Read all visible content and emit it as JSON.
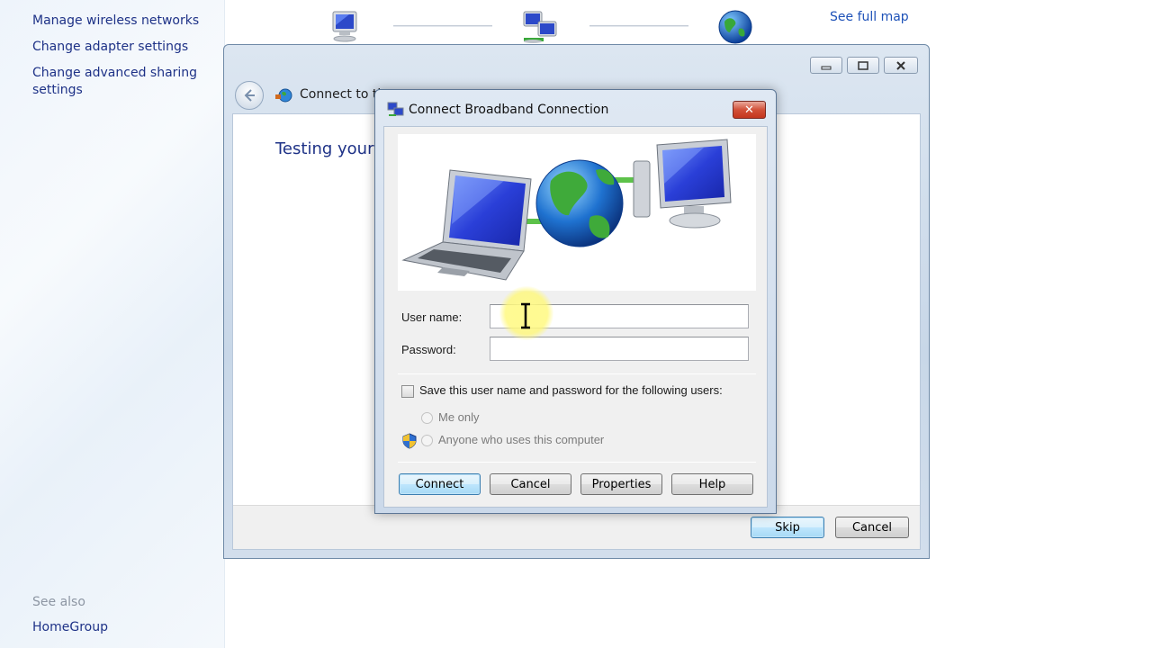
{
  "sidebar": {
    "links": [
      {
        "label": "Manage wireless networks"
      },
      {
        "label": "Change adapter settings"
      },
      {
        "label": "Change advanced sharing settings"
      }
    ],
    "see_also_heading": "See also",
    "see_also_links": [
      {
        "label": "HomeGroup"
      }
    ]
  },
  "network_map": {
    "see_full_map": "See full map",
    "icons": [
      "computer-icon",
      "network-icon",
      "globe-icon"
    ]
  },
  "wizard": {
    "title": "Connect to th",
    "heading": "Testing your",
    "skip_label": "Skip",
    "cancel_label": "Cancel"
  },
  "dialog": {
    "title": "Connect Broadband Connection",
    "close_glyph": "✕",
    "username_label": "User name:",
    "username_value": "",
    "password_label": "Password:",
    "password_value": "",
    "save_checkbox_label": "Save this user name and password for the following users:",
    "save_checked": false,
    "radio_me_only": "Me only",
    "radio_anyone": "Anyone who uses this computer",
    "buttons": {
      "connect": "Connect",
      "cancel": "Cancel",
      "properties": "Properties",
      "help": "Help"
    }
  },
  "colors": {
    "link": "#1e3287",
    "close_red": "#c4361e",
    "accent_blue": "#3c7fb1"
  }
}
